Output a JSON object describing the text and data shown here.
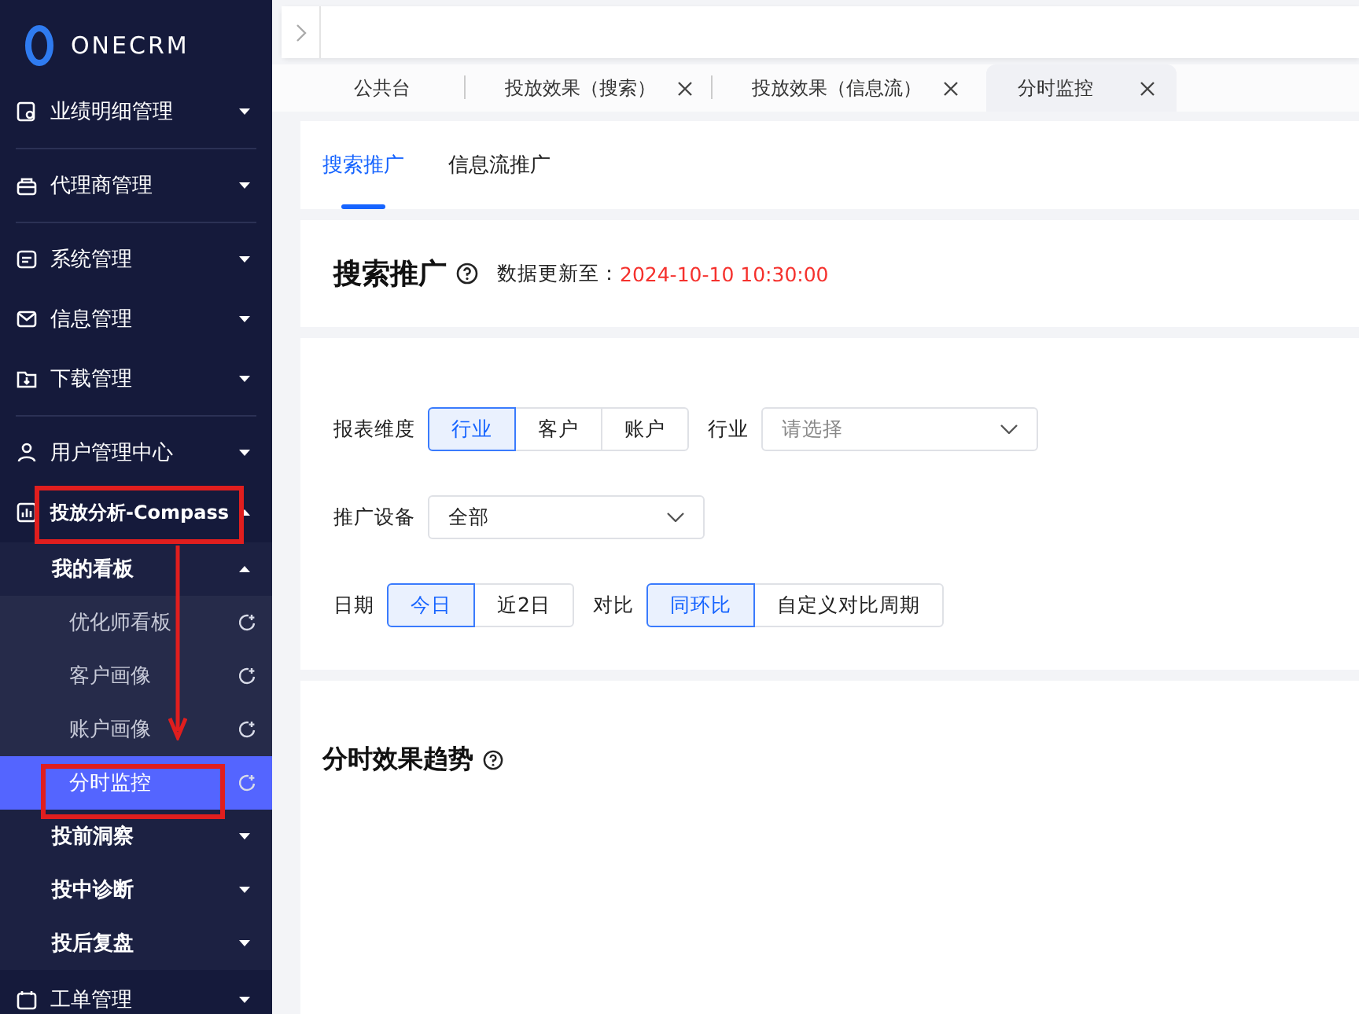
{
  "logo": {
    "text": "ONECRM"
  },
  "sidebar": {
    "items": [
      {
        "label": "业绩明细管理",
        "expanded": false,
        "divider": true
      },
      {
        "label": "代理商管理",
        "expanded": false,
        "divider": true
      },
      {
        "label": "系统管理",
        "expanded": false,
        "divider": false
      },
      {
        "label": "信息管理",
        "expanded": false,
        "divider": false
      },
      {
        "label": "下载管理",
        "expanded": false,
        "divider": true
      },
      {
        "label": "用户管理中心",
        "expanded": false,
        "divider": false
      },
      {
        "label": "投放分析-Compass",
        "expanded": true,
        "divider": false,
        "children": [
          {
            "label": "我的看板",
            "expanded": true,
            "children": [
              {
                "label": "优化师看板",
                "selected": false
              },
              {
                "label": "客户画像",
                "selected": false
              },
              {
                "label": "账户画像",
                "selected": false
              },
              {
                "label": "分时监控",
                "selected": true
              }
            ]
          },
          {
            "label": "投前洞察",
            "expanded": false
          },
          {
            "label": "投中诊断",
            "expanded": false
          },
          {
            "label": "投后复盘",
            "expanded": false
          }
        ]
      },
      {
        "label": "工单管理",
        "expanded": false,
        "divider": false
      }
    ]
  },
  "page_tabs": [
    {
      "label": "公共台",
      "closable": false,
      "selected": false
    },
    {
      "label": "投放效果（搜索）",
      "closable": true,
      "selected": false
    },
    {
      "label": "投放效果（信息流）",
      "closable": true,
      "selected": false
    },
    {
      "label": "分时监控",
      "closable": true,
      "selected": true
    }
  ],
  "sub_tabs": [
    {
      "label": "搜索推广",
      "selected": true
    },
    {
      "label": "信息流推广",
      "selected": false
    }
  ],
  "header": {
    "title": "搜索推广",
    "update_label": "数据更新至：",
    "update_time": "2024-10-10 10:30:00"
  },
  "filters": [
    {
      "controls": [
        {
          "kind": "label",
          "text": "报表维度"
        },
        {
          "kind": "segmented",
          "options": [
            {
              "label": "行业",
              "selected": true
            },
            {
              "label": "客户",
              "selected": false
            },
            {
              "label": "账户",
              "selected": false
            }
          ]
        },
        {
          "kind": "label",
          "text": "行业"
        },
        {
          "kind": "select",
          "placeholder": "请选择"
        }
      ]
    },
    {
      "controls": [
        {
          "kind": "label",
          "text": "推广设备"
        },
        {
          "kind": "select",
          "value": "全部"
        }
      ]
    },
    {
      "controls": [
        {
          "kind": "label",
          "text": "日期"
        },
        {
          "kind": "segmented",
          "options": [
            {
              "label": "今日",
              "selected": true
            },
            {
              "label": "近2日",
              "selected": false
            }
          ]
        },
        {
          "kind": "label",
          "text": "对比"
        },
        {
          "kind": "segmented",
          "options": [
            {
              "label": "同环比",
              "selected": true
            },
            {
              "label": "自定义对比周期",
              "selected": false
            }
          ]
        }
      ]
    }
  ],
  "trend": {
    "title": "分时效果趋势"
  }
}
